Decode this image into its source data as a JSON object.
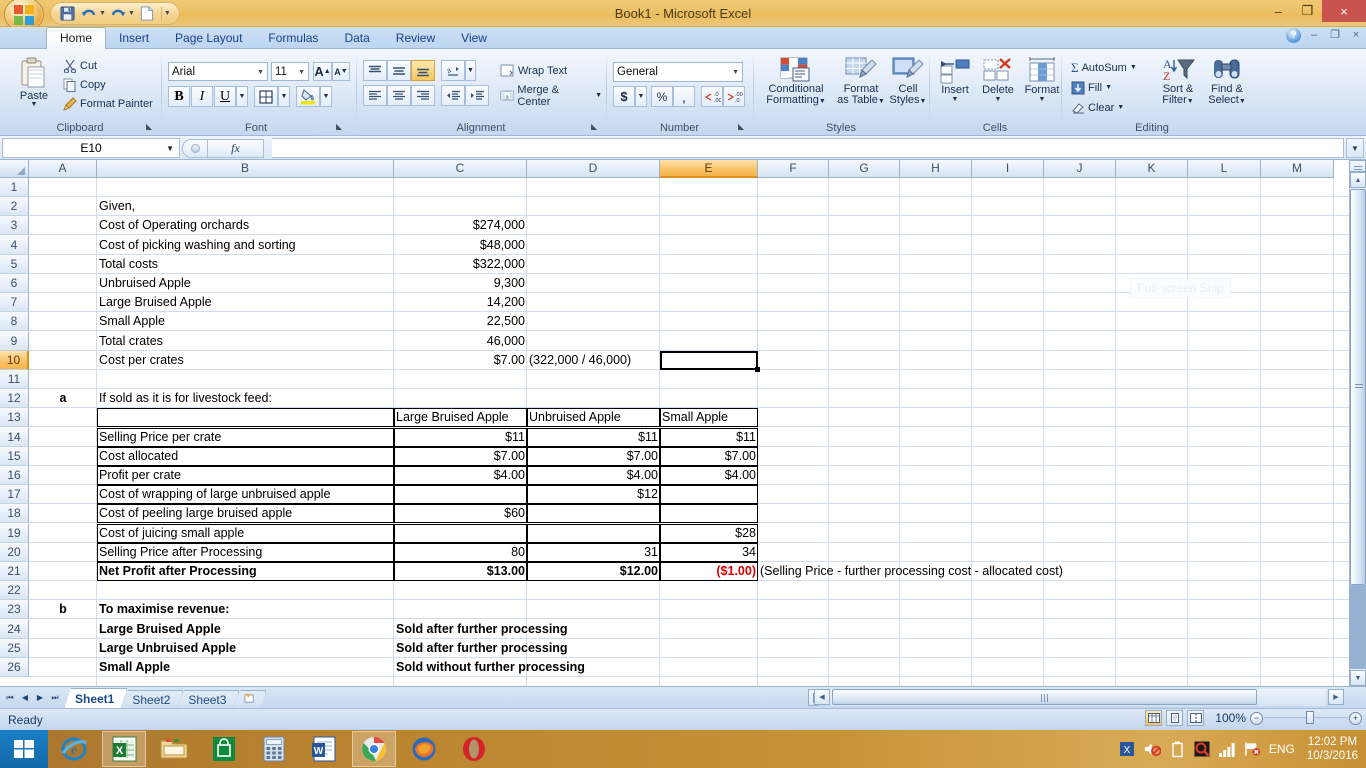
{
  "window": {
    "title": "Book1 - Microsoft Excel",
    "minimize": "–",
    "restore": "❐",
    "close": "×"
  },
  "quick_access": {
    "save": "save-icon",
    "undo": "undo-icon",
    "redo": "redo-icon",
    "new": "new-icon",
    "customize": "customize-icon"
  },
  "ribbon": {
    "tabs": [
      {
        "label": "Home",
        "active": true
      },
      {
        "label": "Insert",
        "active": false
      },
      {
        "label": "Page Layout",
        "active": false
      },
      {
        "label": "Formulas",
        "active": false
      },
      {
        "label": "Data",
        "active": false
      },
      {
        "label": "Review",
        "active": false
      },
      {
        "label": "View",
        "active": false
      }
    ],
    "help": "?",
    "min": "–",
    "restore": "❐",
    "close": "×",
    "groups": {
      "clipboard": {
        "label": "Clipboard",
        "paste": "Paste",
        "cut": "Cut",
        "copy": "Copy",
        "format_painter": "Format Painter"
      },
      "font": {
        "label": "Font",
        "font_name": "Arial",
        "font_size": "11",
        "grow": "A",
        "shrink": "A",
        "bold": "B",
        "italic": "I",
        "underline": "U",
        "borders": "borders-icon",
        "fill_color": "fill-color-icon",
        "font_color": "font-color-icon"
      },
      "alignment": {
        "label": "Alignment",
        "align_top": "align-top-icon",
        "align_middle": "align-middle-icon",
        "align_bottom": "align-bottom-icon",
        "orientation": "orientation-icon",
        "align_left": "align-left-icon",
        "align_center": "align-center-icon",
        "align_right": "align-right-icon",
        "decrease_indent": "decrease-indent-icon",
        "increase_indent": "increase-indent-icon",
        "wrap_text": "Wrap Text",
        "merge_center": "Merge & Center"
      },
      "number": {
        "label": "Number",
        "format": "General",
        "currency": "$",
        "percent": "%",
        "comma": ",",
        "increase_decimal": "increase-decimal-icon",
        "decrease_decimal": "decrease-decimal-icon"
      },
      "styles": {
        "label": "Styles",
        "conditional_formatting": "Conditional\nFormatting",
        "conditional_formatting_l1": "Conditional",
        "conditional_formatting_l2": "Formatting",
        "format_as_table_l1": "Format",
        "format_as_table_l2": "as Table",
        "cell_styles_l1": "Cell",
        "cell_styles_l2": "Styles"
      },
      "cells": {
        "label": "Cells",
        "insert": "Insert",
        "delete": "Delete",
        "format": "Format"
      },
      "editing": {
        "label": "Editing",
        "autosum": "AutoSum",
        "fill": "Fill",
        "clear": "Clear",
        "sort_filter_l1": "Sort &",
        "sort_filter_l2": "Filter",
        "find_select_l1": "Find &",
        "find_select_l2": "Select"
      }
    }
  },
  "formula_bar": {
    "name_box": "E10",
    "fx_label": "fx",
    "formula_value": ""
  },
  "grid": {
    "columns": [
      "A",
      "B",
      "C",
      "D",
      "E",
      "F",
      "G",
      "H",
      "I",
      "J",
      "K",
      "L",
      "M"
    ],
    "selected_column": "E",
    "selected_row": "10",
    "rows": [
      "1",
      "2",
      "3",
      "4",
      "5",
      "6",
      "7",
      "8",
      "9",
      "10",
      "11",
      "12",
      "13",
      "14",
      "15",
      "16",
      "17",
      "18",
      "19",
      "20",
      "21",
      "22",
      "23",
      "24",
      "25",
      "26"
    ],
    "ghost_tooltip": "Full-screen Snip",
    "cells": [
      {
        "row": 2,
        "col": "B",
        "text": "Given,",
        "align": "left"
      },
      {
        "row": 3,
        "col": "B",
        "text": "Cost of Operating orchards",
        "align": "left"
      },
      {
        "row": 3,
        "col": "C",
        "text": "$274,000",
        "align": "right"
      },
      {
        "row": 4,
        "col": "B",
        "text": "Cost of picking washing and sorting",
        "align": "left"
      },
      {
        "row": 4,
        "col": "C",
        "text": "$48,000",
        "align": "right"
      },
      {
        "row": 5,
        "col": "B",
        "text": "Total costs",
        "align": "left"
      },
      {
        "row": 5,
        "col": "C",
        "text": "$322,000",
        "align": "right"
      },
      {
        "row": 6,
        "col": "B",
        "text": "Unbruised Apple",
        "align": "left"
      },
      {
        "row": 6,
        "col": "C",
        "text": "9,300",
        "align": "right"
      },
      {
        "row": 7,
        "col": "B",
        "text": "Large Bruised Apple",
        "align": "left"
      },
      {
        "row": 7,
        "col": "C",
        "text": "14,200",
        "align": "right"
      },
      {
        "row": 8,
        "col": "B",
        "text": "Small Apple",
        "align": "left"
      },
      {
        "row": 8,
        "col": "C",
        "text": "22,500",
        "align": "right"
      },
      {
        "row": 9,
        "col": "B",
        "text": "Total crates",
        "align": "left"
      },
      {
        "row": 9,
        "col": "C",
        "text": "46,000",
        "align": "right"
      },
      {
        "row": 10,
        "col": "B",
        "text": "Cost per crates",
        "align": "left"
      },
      {
        "row": 10,
        "col": "C",
        "text": "$7.00",
        "align": "right"
      },
      {
        "row": 10,
        "col": "D",
        "text": "(322,000 / 46,000)",
        "align": "left"
      },
      {
        "row": 12,
        "col": "A",
        "text": "a",
        "align": "center",
        "bold": true
      },
      {
        "row": 12,
        "col": "B",
        "text": "If sold as it is for livestock feed:",
        "align": "left"
      },
      {
        "row": 13,
        "col": "C",
        "text": "Large Bruised Apple",
        "align": "left"
      },
      {
        "row": 13,
        "col": "D",
        "text": "Unbruised Apple",
        "align": "left"
      },
      {
        "row": 13,
        "col": "E",
        "text": "Small Apple",
        "align": "left"
      },
      {
        "row": 14,
        "col": "B",
        "text": "Selling Price per crate",
        "align": "left"
      },
      {
        "row": 14,
        "col": "C",
        "text": "$11",
        "align": "right"
      },
      {
        "row": 14,
        "col": "D",
        "text": "$11",
        "align": "right"
      },
      {
        "row": 14,
        "col": "E",
        "text": "$11",
        "align": "right"
      },
      {
        "row": 15,
        "col": "B",
        "text": "Cost allocated",
        "align": "left"
      },
      {
        "row": 15,
        "col": "C",
        "text": "$7.00",
        "align": "right"
      },
      {
        "row": 15,
        "col": "D",
        "text": "$7.00",
        "align": "right"
      },
      {
        "row": 15,
        "col": "E",
        "text": "$7.00",
        "align": "right"
      },
      {
        "row": 16,
        "col": "B",
        "text": "Profit per crate",
        "align": "left"
      },
      {
        "row": 16,
        "col": "C",
        "text": "$4.00",
        "align": "right"
      },
      {
        "row": 16,
        "col": "D",
        "text": "$4.00",
        "align": "right"
      },
      {
        "row": 16,
        "col": "E",
        "text": "$4.00",
        "align": "right"
      },
      {
        "row": 17,
        "col": "B",
        "text": "Cost of wrapping of large unbruised apple",
        "align": "left"
      },
      {
        "row": 17,
        "col": "D",
        "text": "$12",
        "align": "right"
      },
      {
        "row": 18,
        "col": "B",
        "text": "Cost of peeling large bruised apple",
        "align": "left"
      },
      {
        "row": 18,
        "col": "C",
        "text": "$60",
        "align": "right"
      },
      {
        "row": 19,
        "col": "B",
        "text": "Cost of juicing small apple",
        "align": "left"
      },
      {
        "row": 19,
        "col": "E",
        "text": "$28",
        "align": "right"
      },
      {
        "row": 20,
        "col": "B",
        "text": "Selling Price after Processing",
        "align": "left"
      },
      {
        "row": 20,
        "col": "C",
        "text": "80",
        "align": "right"
      },
      {
        "row": 20,
        "col": "D",
        "text": "31",
        "align": "right"
      },
      {
        "row": 20,
        "col": "E",
        "text": "34",
        "align": "right"
      },
      {
        "row": 21,
        "col": "B",
        "text": "Net Profit after Processing",
        "align": "left",
        "bold": true
      },
      {
        "row": 21,
        "col": "C",
        "text": "$13.00",
        "align": "right",
        "bold": true
      },
      {
        "row": 21,
        "col": "D",
        "text": "$12.00",
        "align": "right",
        "bold": true
      },
      {
        "row": 21,
        "col": "E",
        "text": "($1.00)",
        "align": "right",
        "bold": true,
        "red": true
      },
      {
        "row": 21,
        "col": "F",
        "text": "(Selling Price - further processing cost - allocated cost)",
        "align": "left"
      },
      {
        "row": 23,
        "col": "A",
        "text": "b",
        "align": "center",
        "bold": true
      },
      {
        "row": 23,
        "col": "B",
        "text": "To maximise revenue:",
        "align": "left",
        "bold": true
      },
      {
        "row": 24,
        "col": "B",
        "text": "Large Bruised Apple",
        "align": "left",
        "bold": true
      },
      {
        "row": 24,
        "col": "C",
        "text": "Sold after further processing",
        "align": "left",
        "bold": true
      },
      {
        "row": 25,
        "col": "B",
        "text": "Large Unbruised Apple",
        "align": "left",
        "bold": true
      },
      {
        "row": 25,
        "col": "C",
        "text": "Sold after further processing",
        "align": "left",
        "bold": true
      },
      {
        "row": 26,
        "col": "B",
        "text": "Small Apple",
        "align": "left",
        "bold": true
      },
      {
        "row": 26,
        "col": "C",
        "text": "Sold without further processing",
        "align": "left",
        "bold": true
      }
    ]
  },
  "sheet_tabs": {
    "first": "⏮",
    "prev": "◀",
    "next": "▶",
    "last": "⏭",
    "items": [
      {
        "label": "Sheet1",
        "active": true
      },
      {
        "label": "Sheet2",
        "active": false
      },
      {
        "label": "Sheet3",
        "active": false
      }
    ],
    "insert_sheet": "insert-worksheet-icon"
  },
  "status_bar": {
    "state": "Ready",
    "view_normal": "normal-view-icon",
    "view_layout": "page-layout-view-icon",
    "view_break": "page-break-view-icon",
    "zoom": "100%",
    "zoom_out": "−",
    "zoom_in": "+"
  },
  "taskbar": {
    "start": "windows-start-icon",
    "items": [
      {
        "name": "internet-explorer-icon",
        "active": false
      },
      {
        "name": "excel-icon",
        "active": true
      },
      {
        "name": "file-explorer-icon",
        "active": false
      },
      {
        "name": "windows-store-icon",
        "active": false
      },
      {
        "name": "calculator-icon",
        "active": false
      },
      {
        "name": "word-icon",
        "active": false
      },
      {
        "name": "chrome-icon",
        "active": true
      },
      {
        "name": "firefox-icon",
        "active": false
      },
      {
        "name": "opera-icon",
        "active": false
      }
    ],
    "tray": {
      "language": "ENG",
      "time": "12:02 PM",
      "date": "10/3/2016"
    }
  },
  "colors": {
    "title_bg": "#eec267",
    "ribbon_bg": "#d3e1f3",
    "selection": "#f8c164",
    "negative": "#e00000",
    "taskbar": "#c69238"
  }
}
